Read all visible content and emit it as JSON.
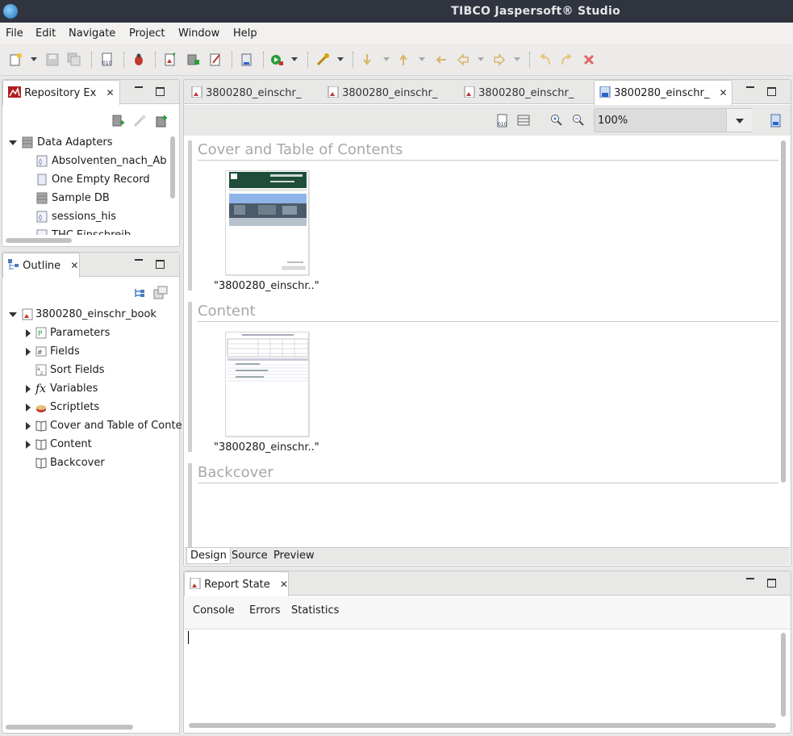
{
  "window": {
    "title": "TIBCO Jaspersoft® Studio"
  },
  "menu": [
    "File",
    "Edit",
    "Navigate",
    "Project",
    "Window",
    "Help"
  ],
  "repository": {
    "tab_label": "Repository Ex",
    "root": "Data Adapters",
    "items": [
      "Absolventen_nach_Ab",
      "One Empty Record",
      "Sample DB",
      "sessions_his",
      "THC Einschreib"
    ]
  },
  "outline": {
    "tab_label": "Outline",
    "root": "3800280_einschr_book",
    "items": [
      "Parameters",
      "Fields",
      "Sort Fields",
      "Variables",
      "Scriptlets",
      "Cover and Table of Conte",
      "Content",
      "Backcover"
    ]
  },
  "editor": {
    "tabs": [
      "3800280_einschr_",
      "3800280_einschr_",
      "3800280_einschr_",
      "3800280_einschr_"
    ],
    "zoom": "100%",
    "sections": [
      {
        "title": "Cover and Table of Contents",
        "caption": "\"3800280_einschr..\""
      },
      {
        "title": "Content",
        "caption": "\"3800280_einschr..\""
      },
      {
        "title": "Backcover"
      }
    ],
    "bottom_tabs": [
      "Design",
      "Source",
      "Preview"
    ]
  },
  "report_state": {
    "tab_label": "Report State",
    "tabs": [
      "Console",
      "Errors",
      "Statistics"
    ]
  }
}
